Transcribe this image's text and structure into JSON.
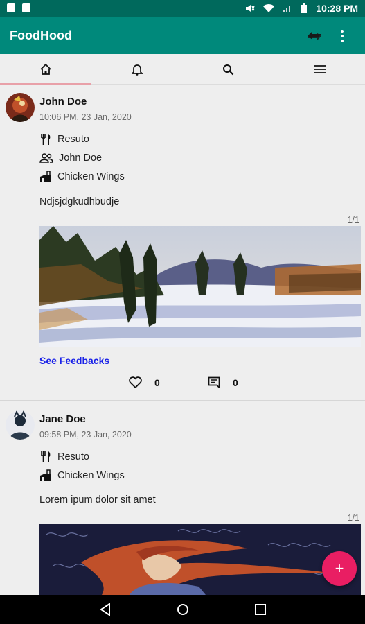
{
  "status_bar": {
    "time": "10:28 PM"
  },
  "app_bar": {
    "title": "FoodHood",
    "sync_icon": "sync-icon",
    "menu_icon": "more-vert-icon"
  },
  "tabs": [
    {
      "icon": "home-icon",
      "selected": true
    },
    {
      "icon": "bell-icon"
    },
    {
      "icon": "search-icon"
    },
    {
      "icon": "hamburger-menu-icon"
    }
  ],
  "posts": [
    {
      "author": "John Doe",
      "timestamp": "10:06 PM, 23 Jan, 2020",
      "restaurant": "Resuto",
      "with": "John Doe",
      "dish": "Chicken Wings",
      "description": "Ndjsjdgkudhbudje",
      "image_counter": "1/1",
      "image_alt": "winter landscape watercolor",
      "feedback_link": "See Feedbacks",
      "likes": "0",
      "comments": "0"
    },
    {
      "author": "Jane Doe",
      "timestamp": "09:58 PM, 23 Jan, 2020",
      "restaurant": "Resuto",
      "dish": "Chicken Wings",
      "description": "Lorem ipum dolor sit amet",
      "image_counter": "1/1",
      "image_alt": "anime character illustration"
    }
  ],
  "fab": {
    "label": "+"
  },
  "colors": {
    "primary": "#00897b",
    "primary_dark": "#00695c",
    "accent": "#e91e63",
    "link": "#1a22e8"
  }
}
